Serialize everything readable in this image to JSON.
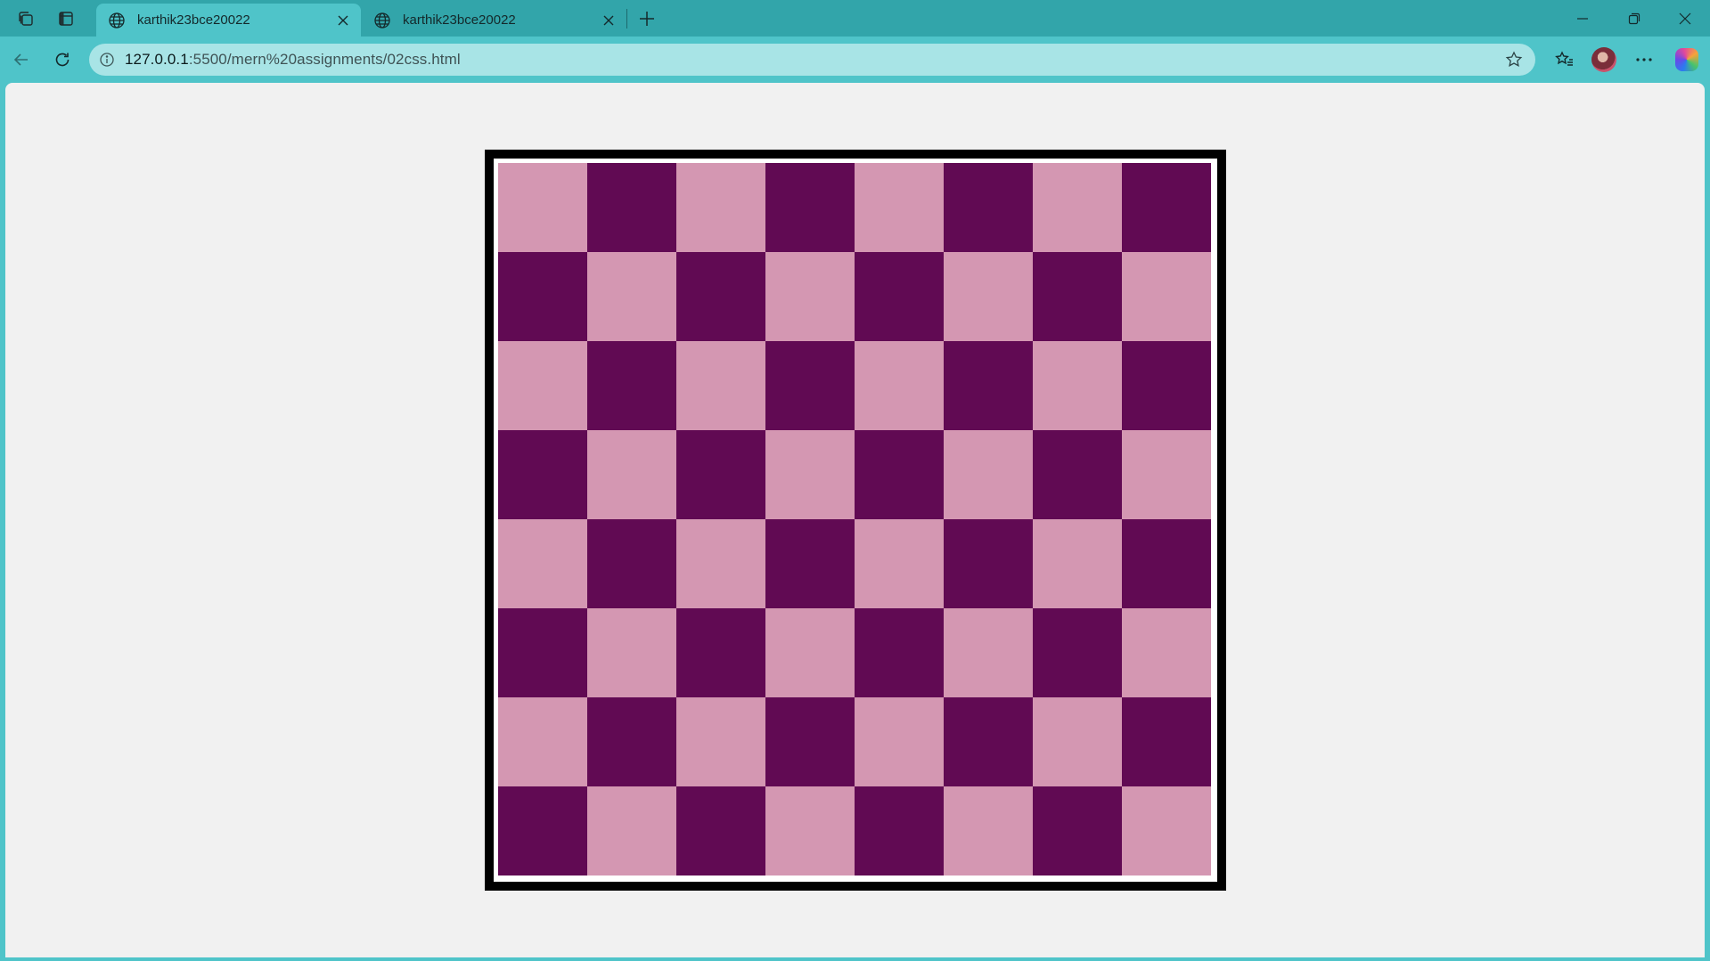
{
  "browser": {
    "tabs": [
      {
        "title": "karthik23bce20022",
        "active": true
      },
      {
        "title": "karthik23bce20022",
        "active": false
      }
    ],
    "address": {
      "host": "127.0.0.1",
      "path": ":5500/mern%20assignments/02css.html"
    }
  },
  "board": {
    "rows": 8,
    "cols": 8,
    "light_color": "#d497b2",
    "dark_color": "#610a53",
    "top_left": "light"
  },
  "colors": {
    "titlebar": "#32a5aa",
    "toolbar": "#4fc4c9",
    "addressbar": "#a8e4e6",
    "page_background": "#f1f1f1",
    "frame": "#000000"
  },
  "icons": {
    "workspaces": "workspaces-icon",
    "tab_actions": "tab-actions-icon",
    "tab": "globe-icon",
    "close": "close-icon",
    "new_tab": "plus-icon",
    "back": "back-arrow-icon",
    "refresh": "refresh-icon",
    "site_info": "info-icon",
    "favorite": "star-icon",
    "favorites": "favorites-icon",
    "profile": "avatar",
    "more": "more-icon",
    "copilot": "copilot-icon"
  }
}
